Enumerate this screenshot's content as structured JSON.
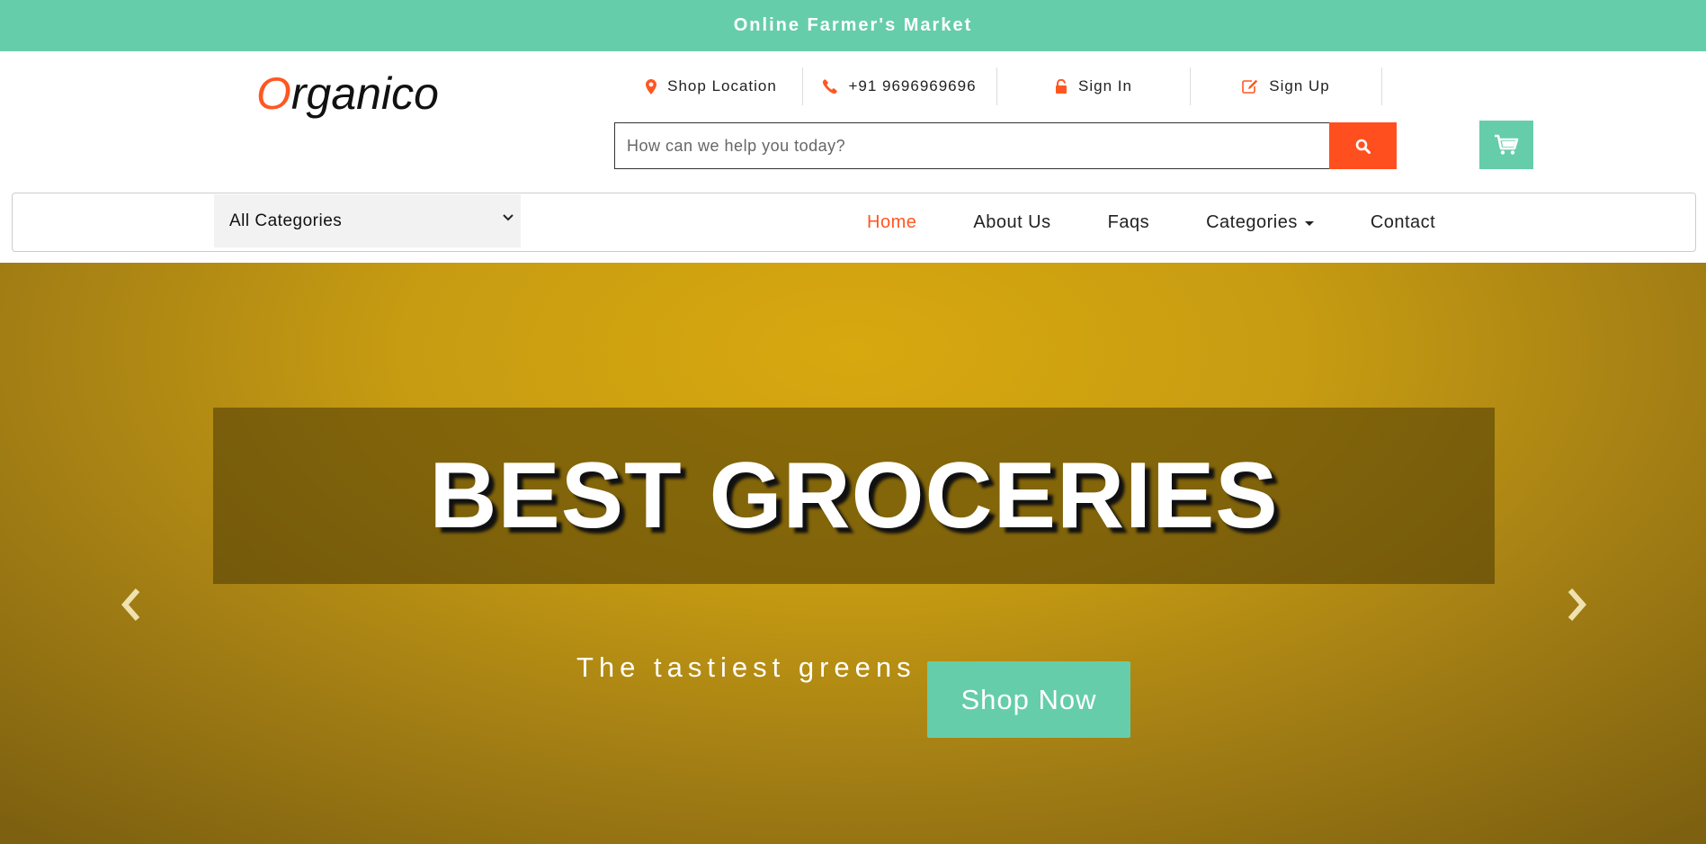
{
  "topbar": {
    "title": "Online Farmer's Market"
  },
  "header": {
    "logo_first": "O",
    "logo_rest": "rganico",
    "links": {
      "location": "Shop Location",
      "phone": "+91 9696969696",
      "signin": "Sign In",
      "signup": "Sign Up"
    },
    "search": {
      "placeholder": "How can we help you today?",
      "value": ""
    }
  },
  "nav": {
    "category_selected": "All Categories",
    "links": [
      "Home",
      "About Us",
      "Faqs",
      "Categories",
      "Contact"
    ],
    "active": "Home"
  },
  "hero": {
    "title": "BEST GROCERIES",
    "subtitle": "The tastiest greens",
    "button": "Shop Now"
  },
  "colors": {
    "accent": "#66cdaa",
    "brand_orange": "#ff5722",
    "search_button": "#ff4f1f",
    "hero_background": "#c79c12"
  }
}
